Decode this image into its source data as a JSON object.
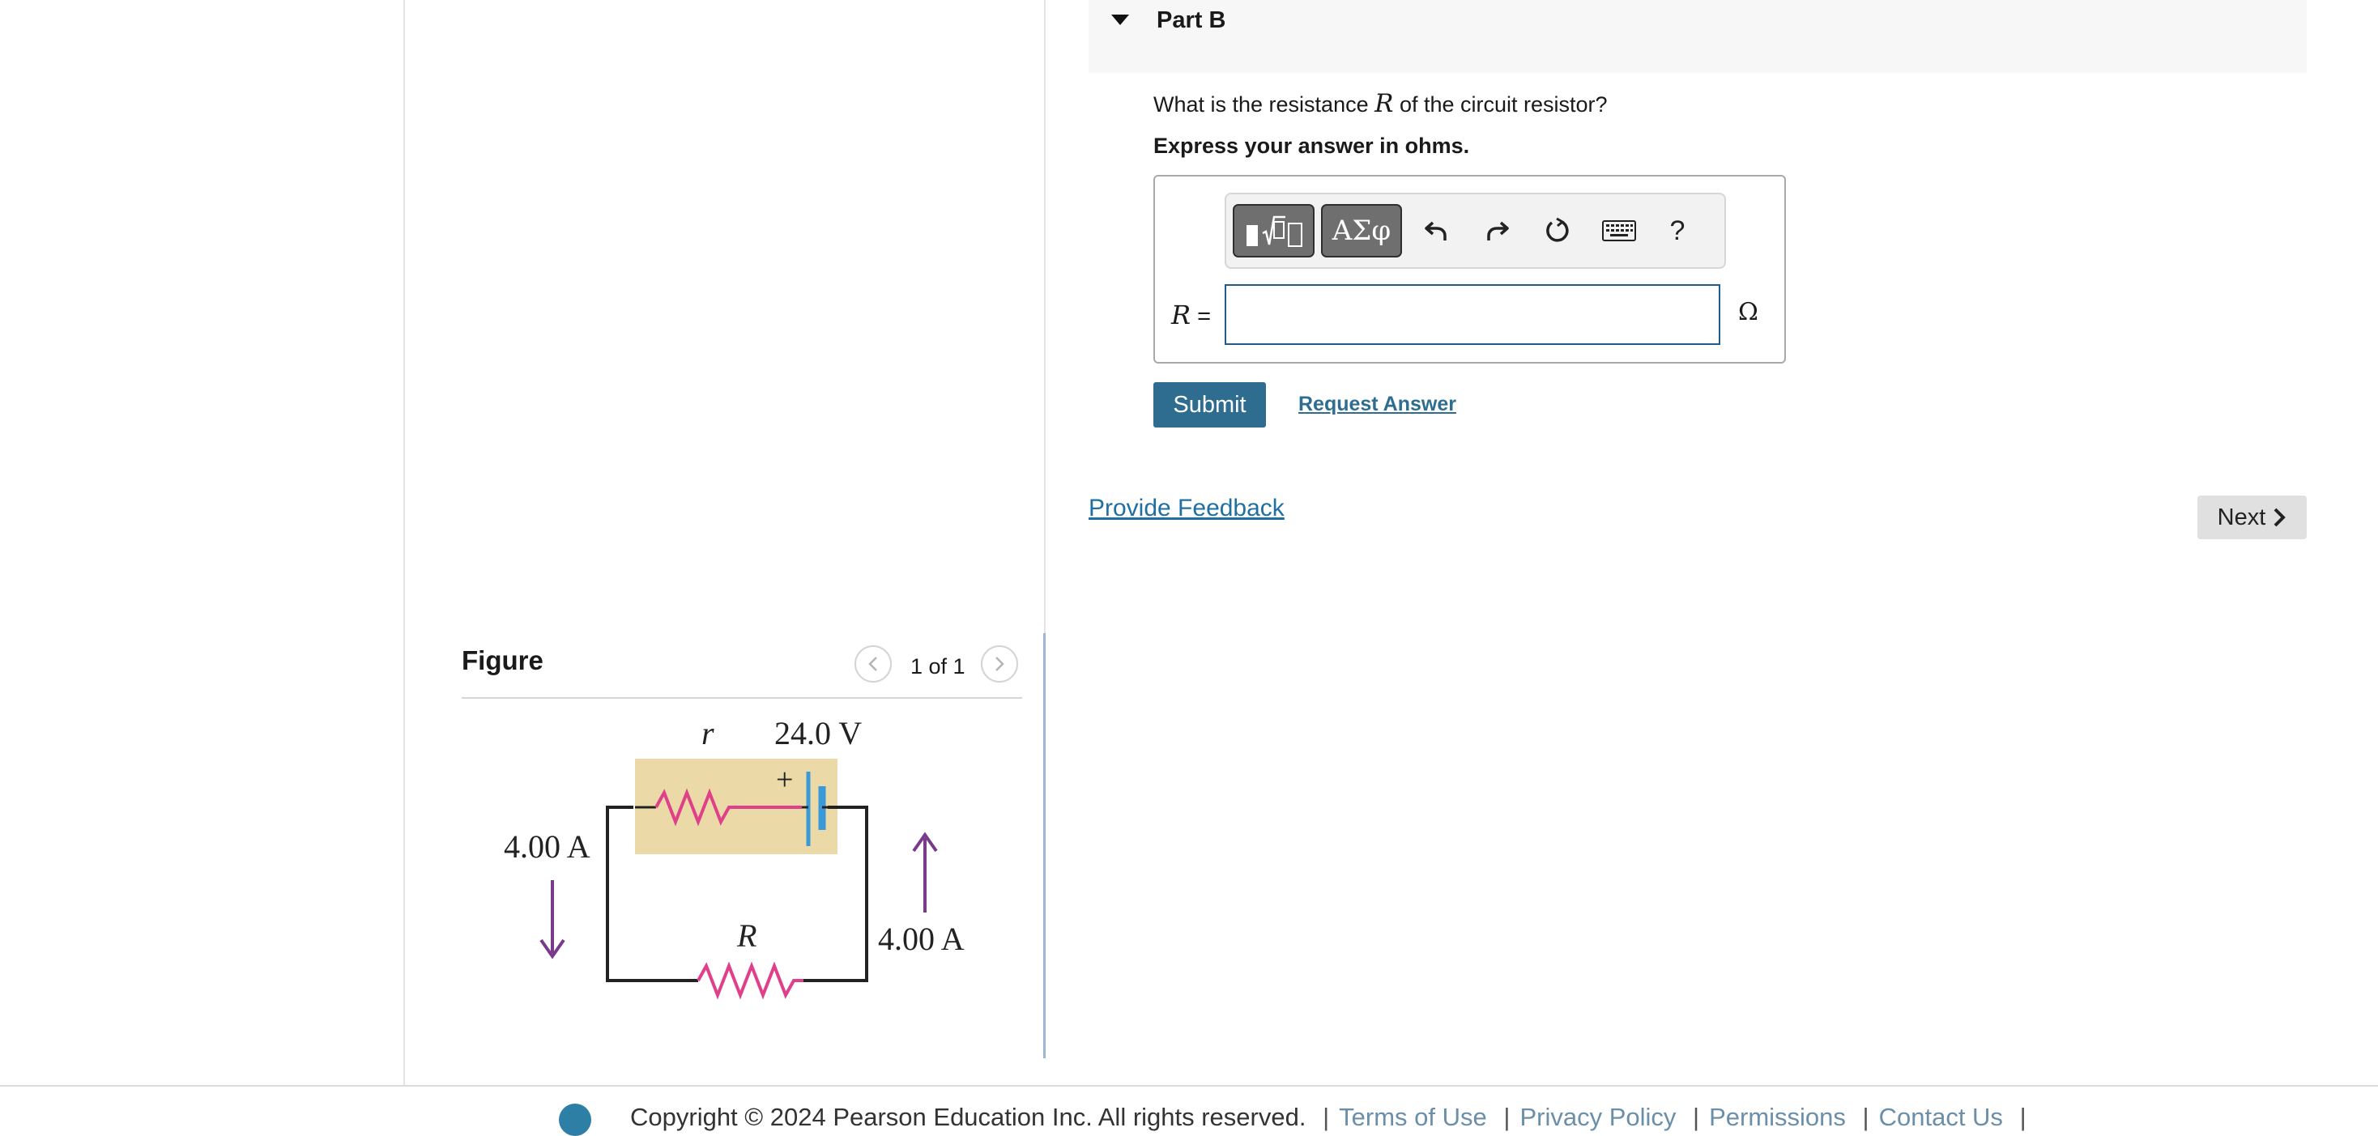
{
  "part": {
    "title": "Part B"
  },
  "question": {
    "text_before": "What is the resistance ",
    "variable": "R",
    "text_after": " of the circuit resistor?",
    "instruction": "Express your answer in ohms."
  },
  "toolbar": {
    "buttons": [
      "templates-icon",
      "ΑΣφ",
      "undo-icon",
      "redo-icon",
      "reset-icon",
      "keyboard-icon",
      "?"
    ],
    "symbols_label": "ΑΣφ",
    "help_label": "?"
  },
  "answer": {
    "label_var": "R",
    "label_eq": " =",
    "value": "",
    "unit": "Ω"
  },
  "actions": {
    "submit_label": "Submit",
    "request_label": "Request Answer",
    "feedback_label": "Provide Feedback",
    "next_label": "Next"
  },
  "figure": {
    "title": "Figure",
    "counter": "1 of 1",
    "labels": {
      "r": "r",
      "emf": "24.0 V",
      "plus": "+",
      "current_left": "4.00 A",
      "current_right": "4.00 A",
      "R": "R"
    }
  },
  "footer": {
    "copyright": "Copyright © 2024 Pearson Education Inc. All rights reserved.",
    "links": [
      "Terms of Use",
      "Privacy Policy",
      "Permissions",
      "Contact Us"
    ]
  },
  "colors": {
    "accent": "#2e6d8f",
    "link": "#1f6fa0",
    "battery_box": "#ecd9a8",
    "resistor": "#e0408a",
    "arrow": "#7a3a8c",
    "battery": "#3a9ad9"
  }
}
